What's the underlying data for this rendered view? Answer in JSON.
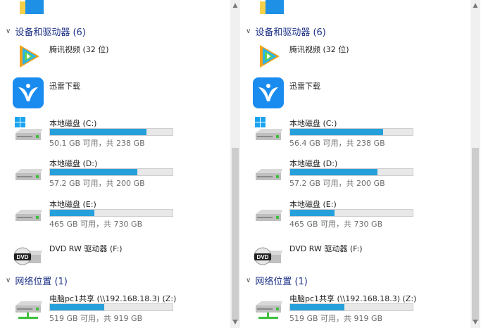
{
  "panes": [
    {
      "groups": {
        "devices": {
          "title": "设备和驱动器 (6)"
        },
        "network": {
          "title": "网络位置 (1)"
        }
      },
      "apps": [
        {
          "name": "腾讯视频 (32 位)",
          "icon": "tencent-video-icon"
        },
        {
          "name": "迅雷下载",
          "icon": "xunlei-icon"
        }
      ],
      "drives": [
        {
          "name": "本地磁盘 (C:)",
          "capacity": "50.1 GB 可用，共 238 GB",
          "used_fraction": 0.79,
          "icon": "windows-drive-icon"
        },
        {
          "name": "本地磁盘 (D:)",
          "capacity": "57.2 GB 可用，共 200 GB",
          "used_fraction": 0.71,
          "icon": "drive-icon"
        },
        {
          "name": "本地磁盘 (E:)",
          "capacity": "465 GB 可用，共 730 GB",
          "used_fraction": 0.36,
          "icon": "drive-icon"
        },
        {
          "name": "DVD RW 驱动器 (F:)",
          "icon": "dvd-drive-icon"
        }
      ],
      "network_drive": {
        "name": "电脑pc1共享 (\\\\192.168.18.3) (Z:)",
        "capacity": "519 GB 可用，共 919 GB",
        "used_fraction": 0.44,
        "icon": "network-drive-icon"
      }
    },
    {
      "groups": {
        "devices": {
          "title": "设备和驱动器 (6)"
        },
        "network": {
          "title": "网络位置 (1)"
        }
      },
      "apps": [
        {
          "name": "腾讯视频 (32 位)",
          "icon": "tencent-video-icon"
        },
        {
          "name": "迅雷下载",
          "icon": "xunlei-icon"
        }
      ],
      "drives": [
        {
          "name": "本地磁盘 (C:)",
          "capacity": "56.4 GB 可用，共 238 GB",
          "used_fraction": 0.76,
          "icon": "windows-drive-icon"
        },
        {
          "name": "本地磁盘 (D:)",
          "capacity": "57.2 GB 可用，共 200 GB",
          "used_fraction": 0.71,
          "icon": "drive-icon"
        },
        {
          "name": "本地磁盘 (E:)",
          "capacity": "465 GB 可用，共 730 GB",
          "used_fraction": 0.36,
          "icon": "drive-icon"
        },
        {
          "name": "DVD RW 驱动器 (F:)",
          "icon": "dvd-drive-icon"
        }
      ],
      "network_drive": {
        "name": "电脑pc1共享 (\\\\192.168.18.3) (Z:)",
        "capacity": "519 GB 可用，共 919 GB",
        "used_fraction": 0.44,
        "icon": "network-drive-icon"
      }
    }
  ],
  "colors": {
    "capacity_fill": "#26a0da",
    "group_title": "#1e3287"
  }
}
